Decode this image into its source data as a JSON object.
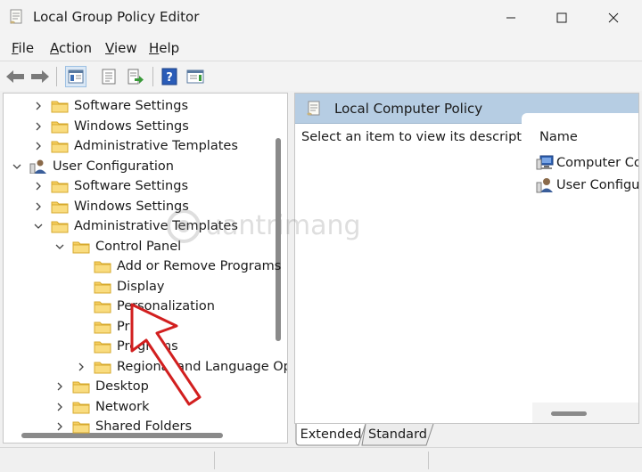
{
  "window": {
    "title": "Local Group Policy Editor",
    "icon": "policy-editor-icon",
    "controls": [
      "minimize-icon",
      "maximize-icon",
      "close-icon"
    ]
  },
  "menu": {
    "file": {
      "accel": "F",
      "rest": "ile"
    },
    "action": {
      "accel": "A",
      "rest": "ction"
    },
    "view": {
      "accel": "V",
      "rest": "iew"
    },
    "help": {
      "accel": "H",
      "rest": "elp"
    }
  },
  "toolbar": {
    "buttons": [
      "back-arrow-icon",
      "forward-arrow-icon",
      "show-hide-tree-icon",
      "properties-icon",
      "export-list-icon",
      "help-icon",
      "show-action-pane-icon"
    ]
  },
  "tree": {
    "items": [
      {
        "label": "Software Settings",
        "level": 1,
        "expander": "collapsed"
      },
      {
        "label": "Windows Settings",
        "level": 1,
        "expander": "collapsed"
      },
      {
        "label": "Administrative Templates",
        "level": 1,
        "expander": "collapsed"
      },
      {
        "label": "User Configuration",
        "level": 0,
        "expander": "expanded"
      },
      {
        "label": "Software Settings",
        "level": 1,
        "expander": "collapsed"
      },
      {
        "label": "Windows Settings",
        "level": 1,
        "expander": "collapsed"
      },
      {
        "label": "Administrative Templates",
        "level": 1,
        "expander": "expanded"
      },
      {
        "label": "Control Panel",
        "level": 2,
        "expander": "expanded"
      },
      {
        "label": "Add or Remove Programs",
        "level": 3,
        "expander": "none"
      },
      {
        "label": "Display",
        "level": 3,
        "expander": "none"
      },
      {
        "label": "Personalization",
        "level": 3,
        "expander": "none"
      },
      {
        "label": "Printers",
        "level": 3,
        "expander": "none"
      },
      {
        "label": "Programs",
        "level": 3,
        "expander": "none"
      },
      {
        "label": "Regional and Language Op",
        "level": 3,
        "expander": "collapsed"
      },
      {
        "label": "Desktop",
        "level": 2,
        "expander": "collapsed"
      },
      {
        "label": "Network",
        "level": 2,
        "expander": "collapsed"
      },
      {
        "label": "Shared Folders",
        "level": 2,
        "expander": "collapsed"
      }
    ]
  },
  "right_pane": {
    "header_title": "Local Computer Policy",
    "description": "Select an item to view its description.",
    "column_name": "Name",
    "items": [
      {
        "label": "Computer Configuration",
        "icon": "computer-config-icon"
      },
      {
        "label": "User Configuration",
        "icon": "user-config-icon"
      }
    ]
  },
  "tabs": {
    "extended": "Extended",
    "standard": "Standard",
    "active": "Extended"
  },
  "watermark": {
    "text": "uantrimang"
  },
  "colors": {
    "header_band": "#b6cde3",
    "folder_fill": "#f6cf62",
    "annotation_arrow": "#d21f1f"
  }
}
